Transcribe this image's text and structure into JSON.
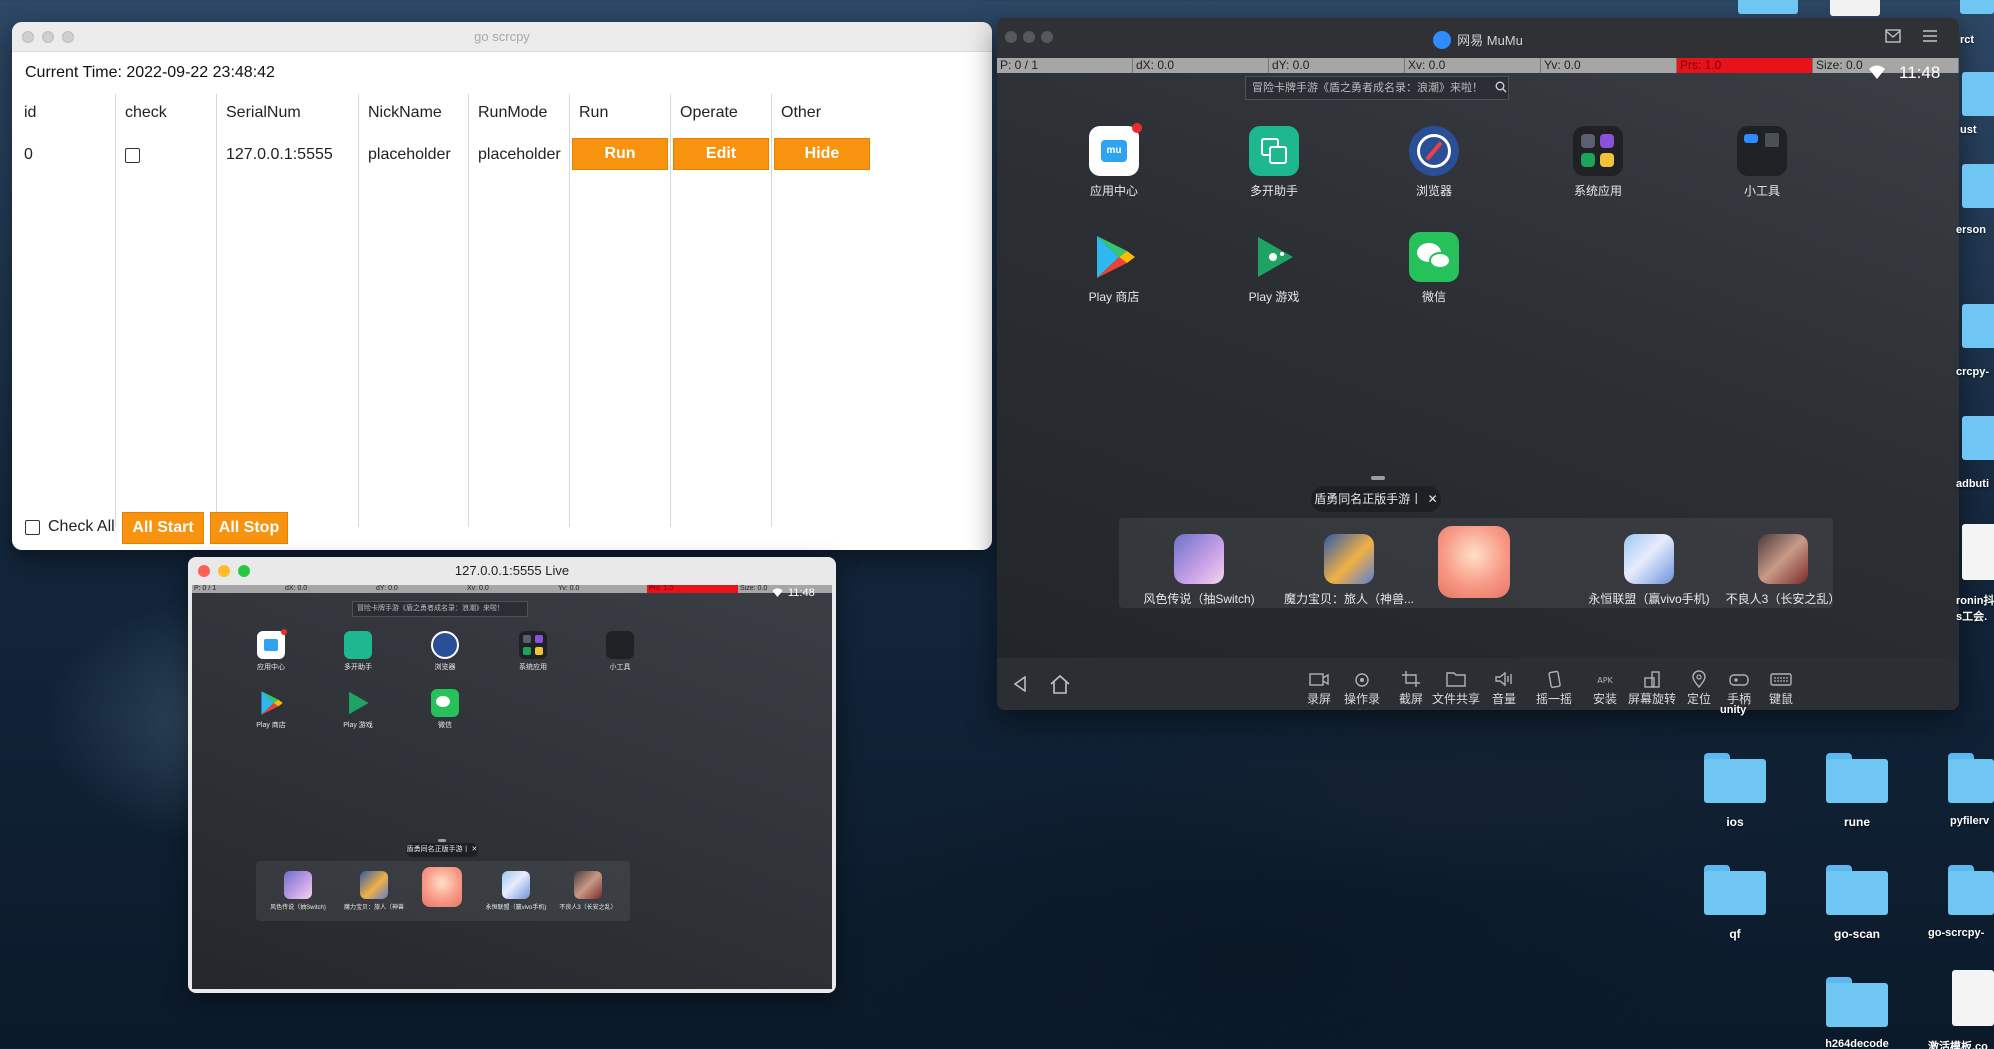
{
  "go_scrcpy": {
    "title": "go scrcpy",
    "current_time": "Current Time: 2022-09-22 23:48:42",
    "headers": [
      "id",
      "check",
      "SerialNum",
      "NickName",
      "RunMode",
      "Run",
      "Operate",
      "Other"
    ],
    "row": {
      "id": "0",
      "serial": "127.0.0.1:5555",
      "nickname": "placeholder",
      "runmode": "placeholder",
      "run": "Run",
      "edit": "Edit",
      "hide": "Hide"
    },
    "check_all": "Check All",
    "all_start": "All Start",
    "all_stop": "All Stop",
    "accent": "#f7930f"
  },
  "mumu": {
    "title": "网易 MuMu",
    "status": {
      "p": "P: 0 / 1",
      "dx": "dX: 0.0",
      "dy": "dY: 0.0",
      "xv": "Xv: 0.0",
      "yv": "Yv: 0.0",
      "prs": "Prs: 1.0",
      "size": "Size: 0.0"
    },
    "clock": "11:48",
    "search_text": "冒险卡牌手游《盾之勇者成名录：浪潮》来啦！",
    "apps": [
      "应用中心",
      "多开助手",
      "浏览器",
      "系统应用",
      "小工具",
      "Play 商店",
      "Play 游戏",
      "微信"
    ],
    "tip": "盾勇同名正版手游丨",
    "dock": [
      "风色传说（抽Switch)",
      "魔力宝贝：旅人（神兽...",
      "",
      "永恒联盟（赢vivo手机)",
      "不良人3（长安之乱）"
    ],
    "tools": [
      "录屏",
      "操作录制",
      "截屏",
      "文件共享",
      "音量",
      "摇一摇",
      "安装",
      "屏幕旋转",
      "定位",
      "手柄",
      "键鼠"
    ]
  },
  "live": {
    "title": "127.0.0.1:5555 Live",
    "status": {
      "p": "P: 0 / 1",
      "dx": "dX: 0.0",
      "dy": "dY: 0.0",
      "xv": "Xv: 0.0",
      "yv": "Yv: 0.0",
      "prs": "Prs: 1.0",
      "size": "Size: 0.0"
    },
    "clock": "11:48",
    "search_text": "冒险卡牌手游《盾之勇者成名录：浪潮》来啦！",
    "apps": [
      "应用中心",
      "多开助手",
      "浏览器",
      "系统应用",
      "小工具",
      "Play 商店",
      "Play 游戏",
      "微信"
    ],
    "tip": "盾勇同名正版手游丨",
    "dock": [
      "风色传说（抽Switch)",
      "魔力宝贝：旅人（神兽",
      "",
      "永恒联盟（赢vivo手机)",
      "不良人3（长安之乱）"
    ]
  },
  "desktop": {
    "folders": [
      "ios",
      "rune",
      "pyfilerv",
      "qf",
      "go-scan",
      "go-scrcpy-",
      "h264decode",
      "激活模板.co"
    ],
    "edge_labels": [
      "rct",
      "ust",
      "erson",
      "crcpy-",
      "adbuti",
      "ronin抖",
      "s工会.",
      "unity"
    ]
  }
}
